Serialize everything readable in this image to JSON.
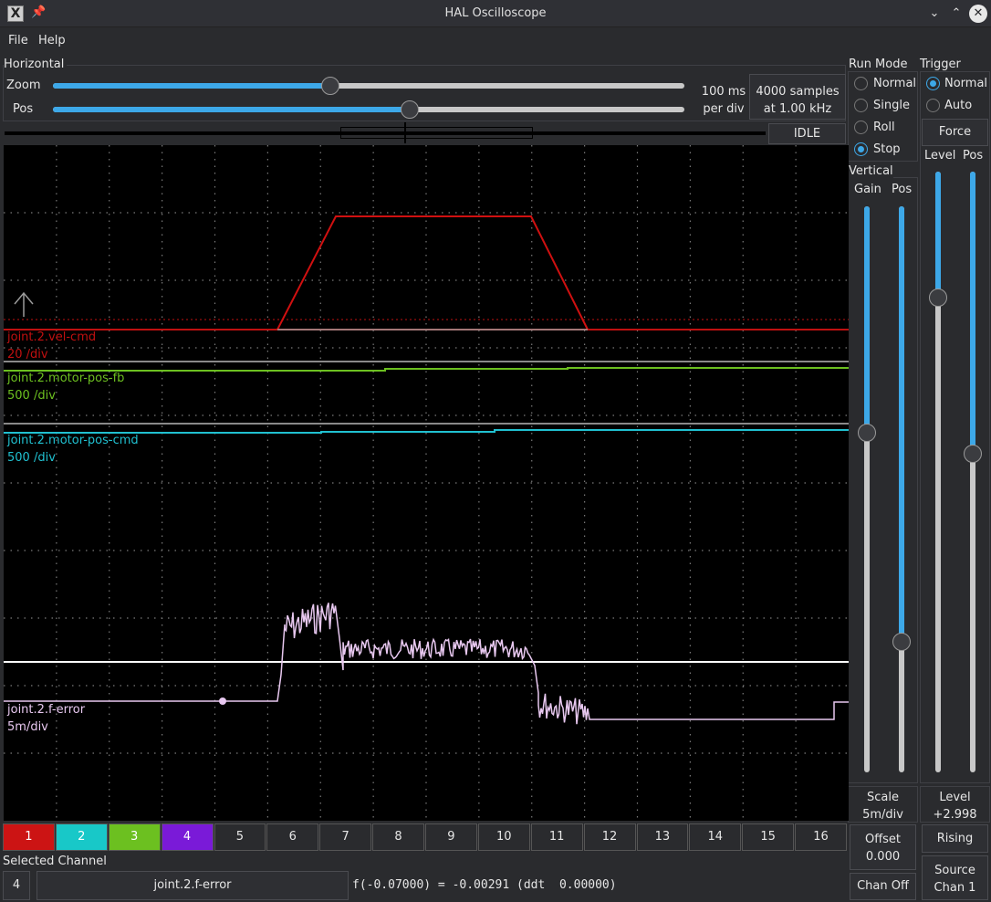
{
  "window": {
    "title": "HAL Oscilloscope"
  },
  "menu": {
    "file": "File",
    "help": "Help"
  },
  "horizontal": {
    "group_label": "Horizontal",
    "zoom_label": "Zoom",
    "pos_label": "Pos",
    "zoom_value": 0.44,
    "pos_value": 0.565,
    "per_div_1": "100 ms",
    "per_div_2": "per div",
    "samples_1": "4000 samples",
    "samples_2": "at 1.00 kHz",
    "status": "IDLE"
  },
  "run_mode": {
    "group_label": "Run Mode",
    "options": [
      "Normal",
      "Single",
      "Roll",
      "Stop"
    ],
    "selected": "Stop"
  },
  "trigger": {
    "group_label": "Trigger",
    "options": [
      "Normal",
      "Auto"
    ],
    "selected": "Normal",
    "force_label": "Force",
    "level_label": "Level",
    "pos_label": "Pos",
    "level_slider": 0.79,
    "pos_slider": 0.53,
    "level_title": "Level",
    "level_value": "+2.998",
    "edge_label": "Rising",
    "source_label_1": "Source",
    "source_label_2": "Chan  1"
  },
  "vertical": {
    "group_label": "Vertical",
    "gain_label": "Gain",
    "pos_label": "Pos",
    "gain_slider": 0.6,
    "pos_slider": 0.23,
    "scale_label": "Scale",
    "scale_value": "5m/div",
    "offset_label": "Offset",
    "offset_value": "0.000",
    "chan_off_label": "Chan Off"
  },
  "traces": [
    {
      "name": "joint.2.vel-cmd",
      "scale": "20 /div",
      "color": "#d01010"
    },
    {
      "name": "joint.2.motor-pos-fb",
      "scale": "500 /div",
      "color": "#6cc020"
    },
    {
      "name": "joint.2.motor-pos-cmd",
      "scale": "500 /div",
      "color": "#20c0d0"
    },
    {
      "name": "joint.2.f-error",
      "scale": "5m/div",
      "color": "#e8c8f0"
    }
  ],
  "channels": {
    "buttons": [
      "1",
      "2",
      "3",
      "4",
      "5",
      "6",
      "7",
      "8",
      "9",
      "10",
      "11",
      "12",
      "13",
      "14",
      "15",
      "16"
    ],
    "colors": [
      "#cc1414",
      "#18c8c8",
      "#6cc020",
      "#7a1ad8"
    ]
  },
  "selected_channel": {
    "label": "Selected Channel",
    "number": "4",
    "name": "joint.2.f-error",
    "readout": "f(-0.07000) = -0.00291 (ddt  0.00000)"
  }
}
